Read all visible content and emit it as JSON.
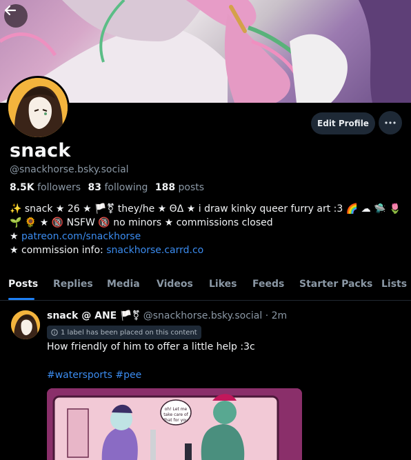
{
  "profile": {
    "display_name": "snack",
    "handle": "@snackhorse.bsky.social",
    "followers_count": "8.5K",
    "followers_label": "followers",
    "following_count": "83",
    "following_label": "following",
    "posts_count": "188",
    "posts_label": "posts"
  },
  "actions": {
    "edit_profile": "Edit Profile",
    "more_icon": "ellipsis-icon",
    "back_icon": "arrow-left-icon"
  },
  "bio": {
    "line1": "✨ snack ★ 26 ★ 🏳️⚧ they/he ★ ΘΔ ★ i draw kinky queer furry art :3 🌈 ☁ 🛸 🌷",
    "line2": "🌱 🌻 ★ 🔞 NSFW 🔞  no minors ★ commissions closed",
    "line3_prefix": "★ ",
    "line3_link": "patreon.com/snackhorse",
    "line4_prefix": "★ commission info: ",
    "line4_link": "snackhorse.carrd.co"
  },
  "tabs": [
    "Posts",
    "Replies",
    "Media",
    "Videos",
    "Likes",
    "Feeds",
    "Starter Packs",
    "Lists"
  ],
  "post": {
    "author": "snack @ ANE 🏳️⚧",
    "handle": "@snackhorse.bsky.social",
    "separator": " · ",
    "time": "2m",
    "label_notice": "1 label has been placed on this content",
    "text": "How friendly of him to offer a little help :3c",
    "tags": "#watersports #pee",
    "image_caption": "oh! Let me take care of that for you"
  },
  "colors": {
    "background": "#000000",
    "link": "#3b8cf0",
    "accent_underline": "#1d80f5",
    "muted": "#8b98a5",
    "button_bg": "#1e2936"
  }
}
